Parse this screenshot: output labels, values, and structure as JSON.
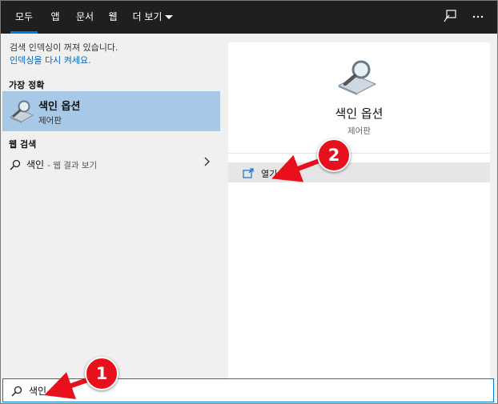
{
  "tabs": [
    {
      "label": "모두"
    },
    {
      "label": "앱"
    },
    {
      "label": "문서"
    },
    {
      "label": "웹"
    },
    {
      "label": "더 보기"
    }
  ],
  "topbar_icons": [
    "feedback-icon",
    "more-options-icon"
  ],
  "left": {
    "notice": "검색 인덱싱이 꺼져 있습니다.",
    "notice_link": "인덱싱을 다시 켜세요.",
    "best_match_header": "가장 정확",
    "best_match": {
      "title": "색인 옵션",
      "subtitle": "제어판"
    },
    "web_header": "웹 검색",
    "web_result": {
      "query": "색인",
      "suffix": "- 웹 결과 보기"
    }
  },
  "right": {
    "title": "색인 옵션",
    "subtitle": "제어판",
    "action_open": "열기"
  },
  "search": {
    "value": "색인"
  },
  "callouts": [
    "1",
    "2"
  ],
  "colors": {
    "accent": "#0078d7",
    "selected": "#a8c8e8",
    "callout": "#e8101c",
    "topbar": "#1f1f1f"
  }
}
